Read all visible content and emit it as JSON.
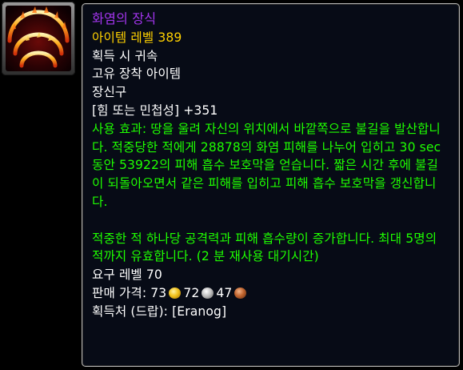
{
  "item": {
    "icon": "ring-of-fire-icon",
    "name": "화염의 장식",
    "item_level": "아이템 레벨 389",
    "binding": "획득 시 귀속",
    "unique": "고유 장착 아이템",
    "slot": "장신구",
    "stat": "[힘 또는 민첩성] +351",
    "use_effect": "사용 효과: 땅을 울려 자신의 위치에서 바깥쪽으로 불길을 발산합니다. 적중당한 적에게 28878의 화염 피해를 나누어 입히고 30 sec 동안 53922의 피해 흡수 보호막을 얻습니다. 짧은 시간 후에 불길이 되돌아오면서 같은 피해를 입히고 피해 흡수 보호막을 갱신합니다.",
    "effect_2": "적중한 적 하나당 공격력과 피해 흡수량이 증가합니다. 최대 5명의 적까지 유효합니다. (2 분 재사용 대기시간)",
    "required_level": "요구 레벨 70",
    "sell_price": {
      "label": "판매 가격: ",
      "gold": "73",
      "silver": "72",
      "copper": "47"
    },
    "source": "획득처 (드랍): [Eranog]"
  },
  "colors": {
    "name": "#a335ee",
    "item_level": "#ffd100",
    "effect": "#1eff00",
    "text": "#ffffff",
    "background": "#070b16",
    "border": "#b8b8b8"
  }
}
